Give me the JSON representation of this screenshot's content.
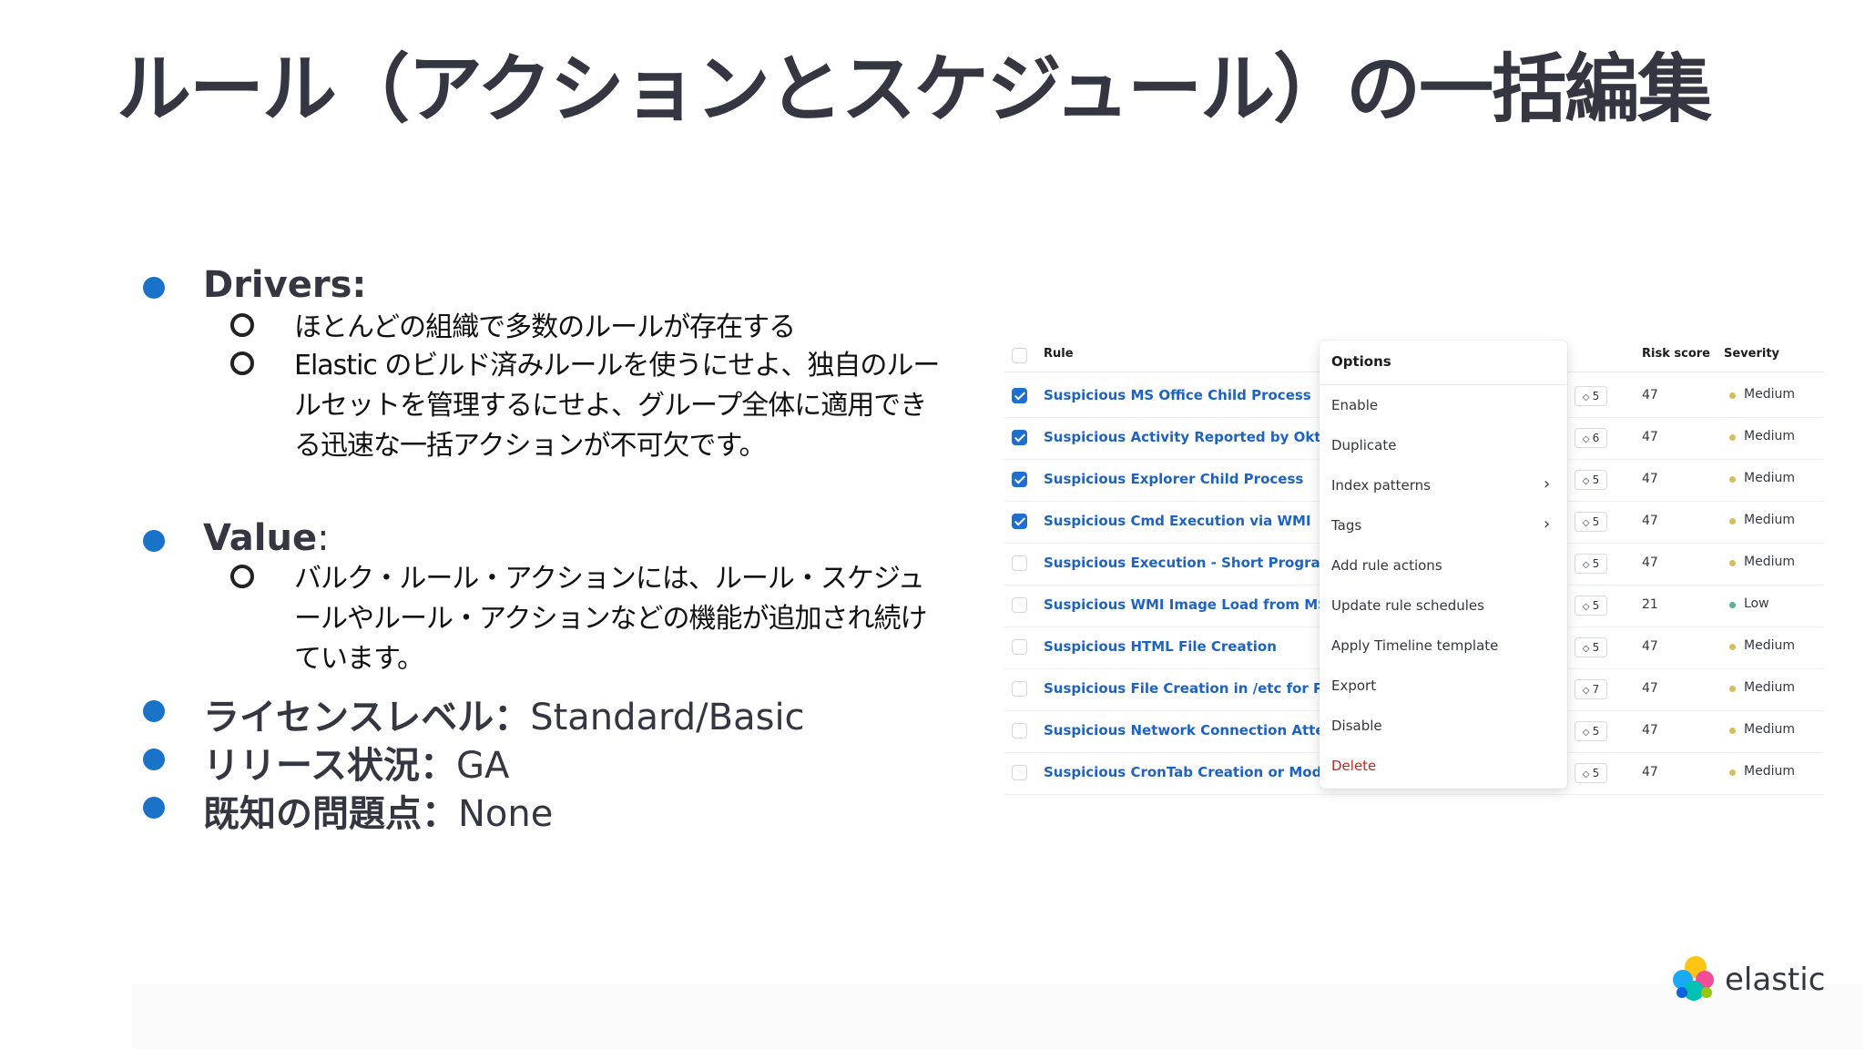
{
  "title": "ルール（アクションとスケジュール）の一括編集",
  "bullets": {
    "drivers": {
      "label": "Drivers:",
      "items": [
        "ほとんどの組織で多数のルールが存在する",
        "Elastic のビルド済みルールを使うにせよ、独自のルールセットを管理するにせよ、グループ全体に適用できる迅速な一括アクションが不可欠です。"
      ]
    },
    "value": {
      "label": "Value",
      "colon": ":",
      "items": [
        "バルク・ルール・アクションには、ルール・スケジュールやルール・アクションなどの機能が追加され続けています。"
      ]
    },
    "license": {
      "label": "ライセンスレベル：",
      "value": "Standard/Basic"
    },
    "release": {
      "label": "リリース状況：",
      "value": "GA"
    },
    "issues": {
      "label": "既知の問題点：",
      "value": "None"
    }
  },
  "screenshot": {
    "headers": {
      "rule": "Rule",
      "risk_score": "Risk score",
      "severity": "Severity"
    },
    "rows": [
      {
        "name": "Suspicious MS Office Child Process",
        "checked": true,
        "tags": "5",
        "risk": "47",
        "severity": "Medium"
      },
      {
        "name": "Suspicious Activity Reported by Okta User",
        "checked": true,
        "tags": "6",
        "risk": "47",
        "severity": "Medium"
      },
      {
        "name": "Suspicious Explorer Child Process",
        "checked": true,
        "tags": "5",
        "risk": "47",
        "severity": "Medium"
      },
      {
        "name": "Suspicious Cmd Execution via WMI",
        "checked": true,
        "tags": "5",
        "risk": "47",
        "severity": "Medium"
      },
      {
        "name": "Suspicious Execution - Short Program Name",
        "checked": false,
        "tags": "5",
        "risk": "47",
        "severity": "Medium"
      },
      {
        "name": "Suspicious WMI Image Load from MS Office",
        "checked": false,
        "tags": "5",
        "risk": "21",
        "severity": "Low"
      },
      {
        "name": "Suspicious HTML File Creation",
        "checked": false,
        "tags": "5",
        "risk": "47",
        "severity": "Medium"
      },
      {
        "name": "Suspicious File Creation in /etc for Persistence",
        "checked": false,
        "tags": "7",
        "risk": "47",
        "severity": "Medium"
      },
      {
        "name": "Suspicious Network Connection Attempt by Root",
        "checked": false,
        "tags": "5",
        "risk": "47",
        "severity": "Medium"
      },
      {
        "name": "Suspicious CronTab Creation or Modification",
        "checked": false,
        "tags": "5",
        "risk": "47",
        "severity": "Medium"
      }
    ],
    "menu": {
      "title": "Options",
      "items": [
        {
          "label": "Enable"
        },
        {
          "label": "Duplicate"
        },
        {
          "label": "Index patterns",
          "submenu": true
        },
        {
          "label": "Tags",
          "submenu": true
        },
        {
          "label": "Add rule actions"
        },
        {
          "label": "Update rule schedules"
        },
        {
          "label": "Apply Timeline template"
        },
        {
          "label": "Export"
        },
        {
          "label": "Disable"
        },
        {
          "label": "Delete",
          "danger": true
        }
      ]
    },
    "colors": {
      "link": "#1d63c4",
      "medium": "#d6bf57",
      "low": "#54b399",
      "danger": "#bd271e",
      "accent": "#1a73c9"
    }
  },
  "logo": {
    "text": "elastic"
  }
}
